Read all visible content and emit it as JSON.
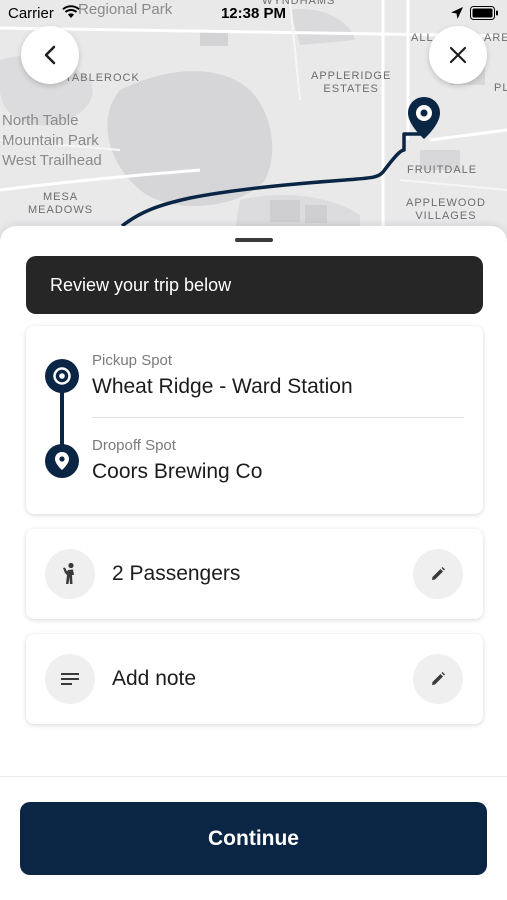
{
  "status_bar": {
    "carrier": "Carrier",
    "time": "12:38 PM"
  },
  "map": {
    "labels": {
      "regional_park": "Regional Park",
      "wyndhams": "WYNDHAMS",
      "tablerock": "TABLEROCK",
      "appleridge_estates": "APPLERIDGE\nESTATES",
      "north_table": "North Table\nMountain Park\nWest Trailhead",
      "fruitdale": "FRUITDALE",
      "applewood_villages": "APPLEWOOD\nVILLAGES",
      "mesa_meadows": "MESA\nMEADOWS",
      "all": "ALL",
      "are": "ARE",
      "pl": "PL"
    },
    "route_color": "#0b2545"
  },
  "header": {
    "back_icon": "chevron-left-icon",
    "close_icon": "close-icon"
  },
  "banner": {
    "text": "Review your trip below"
  },
  "route": {
    "pickup_label": "Pickup Spot",
    "pickup_value": "Wheat Ridge - Ward Station",
    "dropoff_label": "Dropoff Spot",
    "dropoff_value": "Coors Brewing Co"
  },
  "passengers": {
    "icon": "person-icon",
    "text": "2 Passengers",
    "edit_icon": "pencil-icon"
  },
  "note": {
    "icon": "notes-icon",
    "text": "Add note",
    "edit_icon": "pencil-icon"
  },
  "continue": {
    "label": "Continue"
  },
  "colors": {
    "primary": "#0b2545",
    "banner_bg": "#262626"
  }
}
